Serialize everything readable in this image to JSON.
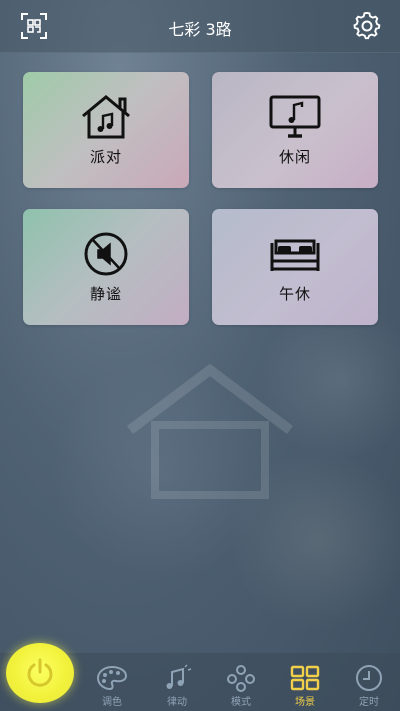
{
  "header": {
    "title": "七彩 3路"
  },
  "scenes": [
    {
      "label": "派对",
      "icon": "house-music-icon"
    },
    {
      "label": "休闲",
      "icon": "tv-music-icon"
    },
    {
      "label": "静谧",
      "icon": "mute-icon"
    },
    {
      "label": "午休",
      "icon": "bed-icon"
    }
  ],
  "nav": [
    {
      "label": "调色",
      "icon": "palette-icon"
    },
    {
      "label": "律动",
      "icon": "music-note-icon"
    },
    {
      "label": "模式",
      "icon": "mode-dots-icon"
    },
    {
      "label": "场景",
      "icon": "scene-grid-icon",
      "active": true
    },
    {
      "label": "定时",
      "icon": "clock-icon"
    }
  ],
  "colors": {
    "accent": "#f2cf48",
    "power": "#f2f23c",
    "nav_inactive": "#8fa3b6"
  }
}
